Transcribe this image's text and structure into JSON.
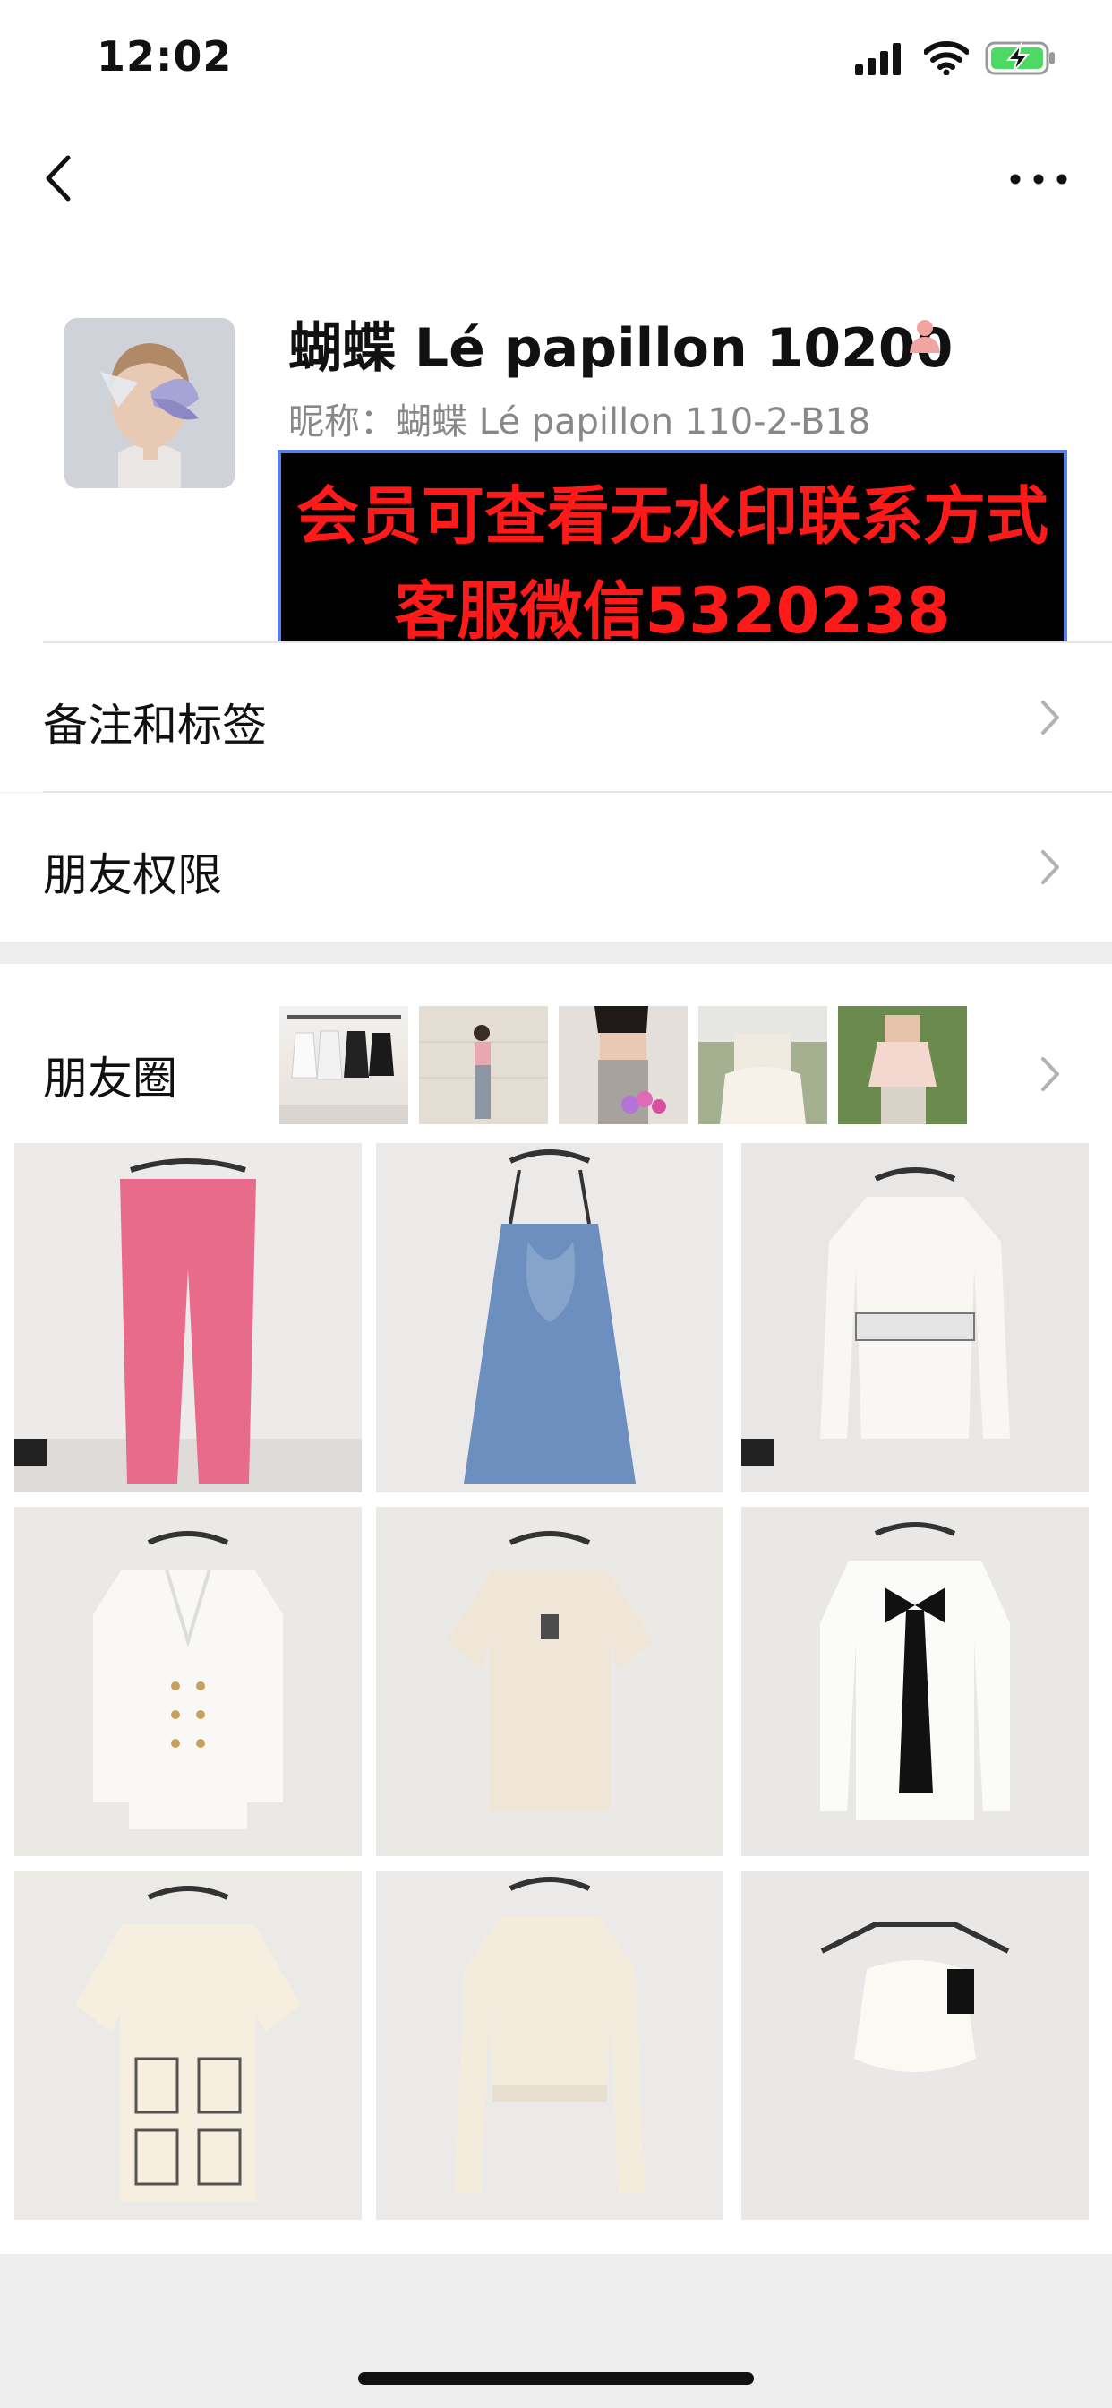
{
  "status_bar": {
    "time": "12:02"
  },
  "profile": {
    "name": "蝴蝶 Lé papillon 10200",
    "nickname": "昵称：蝴蝶 Lé papillon 110-2-B18"
  },
  "banner": {
    "line1": "会员可查看无水印联系方式",
    "line2": "客服微信5320238",
    "text_color": "#ff1a1a"
  },
  "rows": {
    "remarks_label": "备注和标签",
    "permissions_label": "朋友权限"
  },
  "moments": {
    "label": "朋友圈",
    "thumbnail_count": 5,
    "grid_item_count": 9
  },
  "icons": {
    "back": "chevron-left-icon",
    "more": "ellipsis-icon",
    "person": "person-icon",
    "row_arrow": "chevron-right-icon"
  }
}
